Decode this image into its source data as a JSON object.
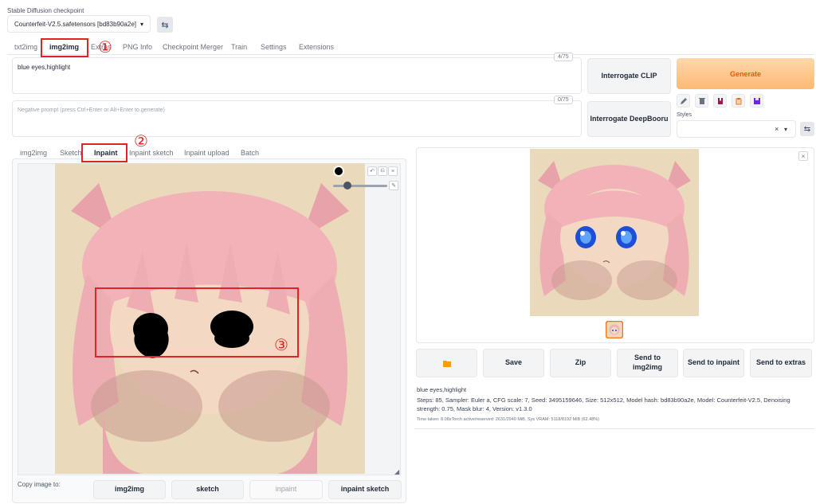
{
  "checkpoint": {
    "label": "Stable Diffusion checkpoint",
    "value": "Counterfeit-V2.5.safetensors [bd83b90a2e]",
    "dropdown_icon": "caret-down",
    "swap_icon": "refresh-swap-icon"
  },
  "main_tabs": [
    "txt2img",
    "img2img",
    "Extras",
    "PNG Info",
    "Checkpoint Merger",
    "Train",
    "Settings",
    "Extensions"
  ],
  "prompt": {
    "value": "blue eyes,highlight",
    "count": "4/75"
  },
  "negative_prompt": {
    "placeholder": "Negative prompt (press Ctrl+Enter or Alt+Enter to generate)",
    "count": "0/75"
  },
  "interrogate": {
    "clip": "Interrogate CLIP",
    "deepbooru": "Interrogate DeepBooru"
  },
  "generate": {
    "label": "Generate",
    "color": "#fdba74"
  },
  "tools": [
    "pencil-icon",
    "trash-icon",
    "bookmark-icon",
    "clipboard-icon",
    "save-icon"
  ],
  "styles": {
    "label": "Styles",
    "clear": "×",
    "caret": "▾"
  },
  "sub_tabs": [
    "img2img",
    "Sketch",
    "Inpaint",
    "Inpaint sketch",
    "Inpaint upload",
    "Batch"
  ],
  "copy_to": {
    "label": "Copy image to:",
    "buttons": [
      "img2img",
      "sketch",
      "inpaint",
      "inpaint sketch"
    ]
  },
  "output_buttons": {
    "folder_icon": "folder-icon",
    "save": "Save",
    "zip": "Zip",
    "send_img2img": "Send to img2img",
    "send_inpaint": "Send to inpaint",
    "send_extras": "Send to extras"
  },
  "info": {
    "prompt": "blue eyes,highlight",
    "params": "Steps: 85, Sampler: Euler a, CFG scale: 7, Seed: 3495159646, Size: 512x512, Model hash: bd83b90a2e, Model: Counterfeit-V2.5, Denoising strength: 0.75, Mask blur: 4, Version: v1.3.0",
    "time": "Time taken: 8.08sTorch active/reserved: 2631/2940 MiB, Sys VRAM: 5118/8192 MiB (62.48%)"
  },
  "annotations": [
    "①",
    "②",
    "③"
  ],
  "close_icon": "×",
  "accent_red": "#e02424"
}
